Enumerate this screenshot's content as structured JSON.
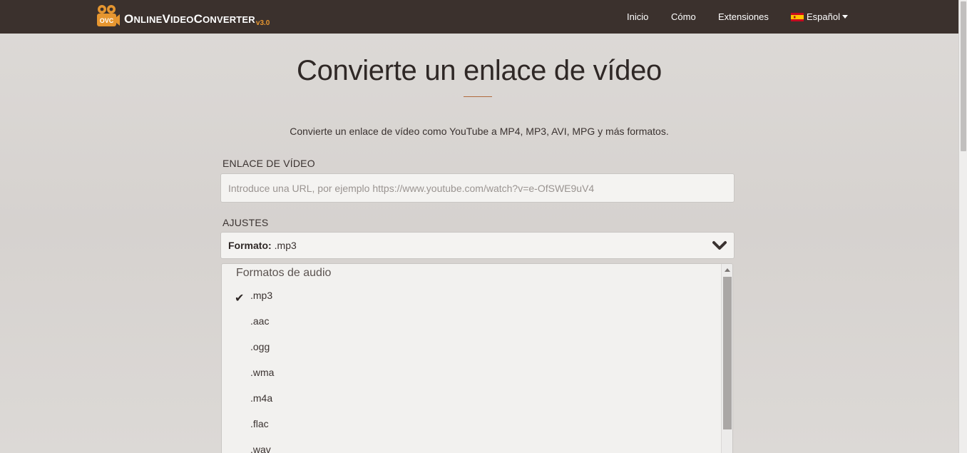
{
  "brand": {
    "logo_text": "OVC",
    "name_parts": [
      {
        "big": "O",
        "small": "NLINE"
      },
      {
        "big": "V",
        "small": "IDEO"
      },
      {
        "big": "C",
        "small": "ONVERTER"
      }
    ],
    "version": "v3.0"
  },
  "nav": {
    "home": "Inicio",
    "how": "Cómo",
    "extensions": "Extensiones",
    "language": "Español"
  },
  "hero": {
    "title": "Convierte un enlace de vídeo",
    "subtitle": "Convierte un enlace de vídeo como YouTube a MP4, MP3, AVI, MPG y más formatos."
  },
  "form": {
    "video_link_label": "ENLACE DE VÍDEO",
    "url_value": "",
    "url_placeholder": "Introduce una URL, por ejemplo https://www.youtube.com/watch?v=e-OfSWE9uV4",
    "settings_label": "AJUSTES",
    "format_key": "Formato:",
    "format_value": ".mp3"
  },
  "dropdown": {
    "group_title": "Formatos de audio",
    "selected": ".mp3",
    "options": [
      ".mp3",
      ".aac",
      ".ogg",
      ".wma",
      ".m4a",
      ".flac",
      ".wav"
    ]
  },
  "colors": {
    "navbar": "#3b312d",
    "accent": "#e69630",
    "rule": "#b06a3c"
  }
}
